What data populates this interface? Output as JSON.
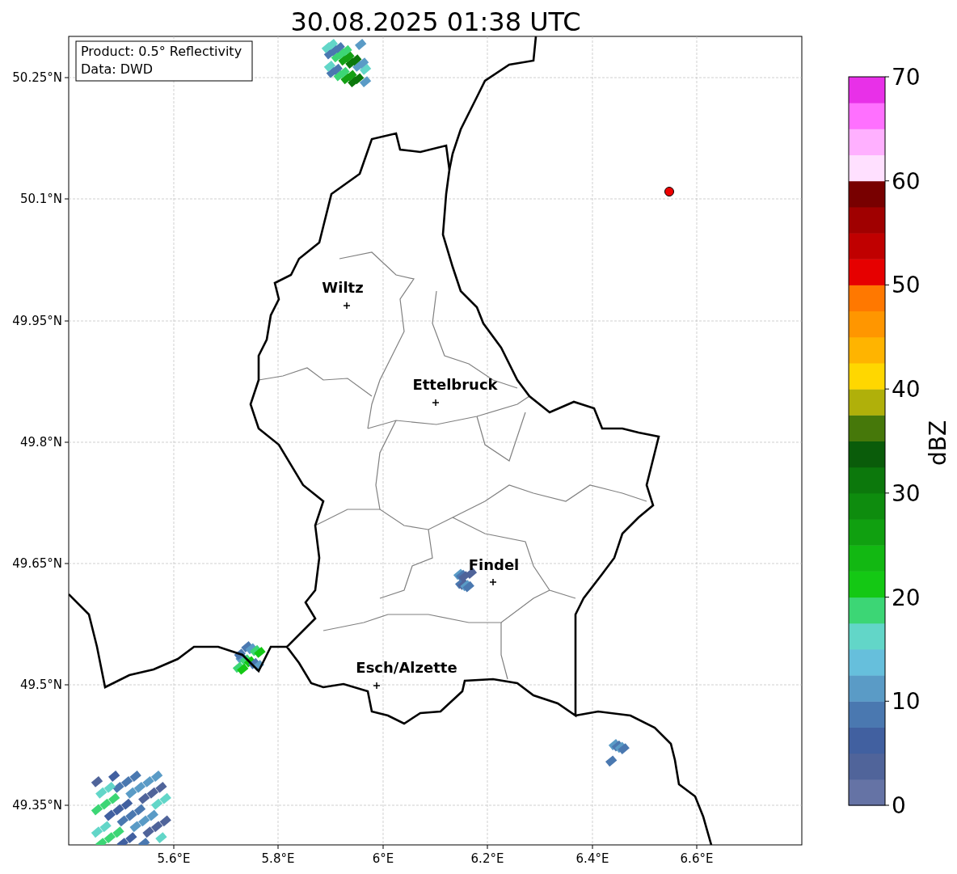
{
  "title": "30.08.2025 01:38 UTC",
  "info_box": [
    "Product: 0.5° Reflectivity",
    "Data: DWD"
  ],
  "lon_ticks": [
    "5.6°E",
    "5.8°E",
    "6°E",
    "6.2°E",
    "6.4°E",
    "6.6°E"
  ],
  "lat_ticks": [
    "50.25°N",
    "50.1°N",
    "49.95°N",
    "49.8°N",
    "49.65°N",
    "49.5°N",
    "49.35°N"
  ],
  "cities": [
    "Wiltz",
    "Ettelbruck",
    "Findel",
    "Esch/Alzette"
  ],
  "colorbar": {
    "label": "dBZ",
    "ticks": [
      "70",
      "60",
      "50",
      "40",
      "30",
      "20",
      "10",
      "0"
    ]
  }
}
